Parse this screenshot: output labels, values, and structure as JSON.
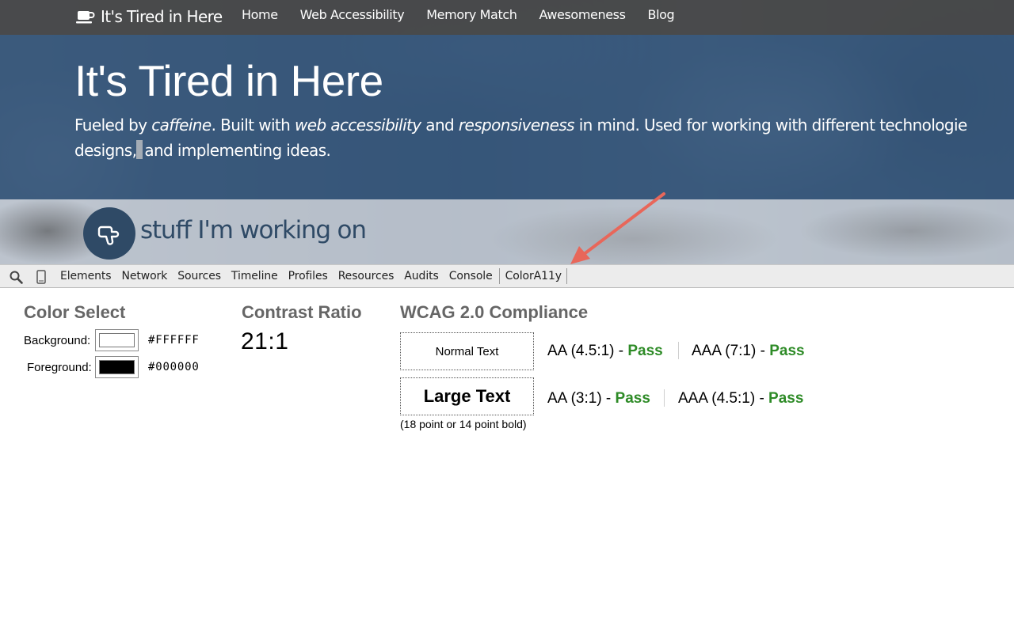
{
  "site": {
    "logo_text": "It's Tired in Here",
    "nav": [
      "Home",
      "Web Accessibility",
      "Memory Match",
      "Awesomeness",
      "Blog"
    ],
    "hero_title": "It's Tired in Here",
    "hero_sub": {
      "p1": "Fueled by ",
      "e1": "caffeine",
      "p2": ". Built with ",
      "e2": "web accessibility",
      "p3": " and ",
      "e3": "responsiveness",
      "p4": " in mind. Used for working with different technologie",
      "line2a": "designs,",
      "line2b": "and implementing ideas."
    },
    "section_title": "stuff I'm working on",
    "icons": {
      "logo": "coffee-cup-icon",
      "section": "pointing-hand-icon"
    }
  },
  "devtools": {
    "icons": {
      "search": "search-icon",
      "device": "mobile-device-icon"
    },
    "tabs": [
      "Elements",
      "Network",
      "Sources",
      "Timeline",
      "Profiles",
      "Resources",
      "Audits",
      "Console",
      "ColorA11y"
    ],
    "active_tab": "ColorA11y"
  },
  "color_select": {
    "heading": "Color Select",
    "background_label": "Background:",
    "background_hex": "#FFFFFF",
    "background_color": "#FFFFFF",
    "foreground_label": "Foreground:",
    "foreground_hex": "#000000",
    "foreground_color": "#000000"
  },
  "contrast": {
    "heading": "Contrast Ratio",
    "value": "21:1"
  },
  "wcag": {
    "heading": "WCAG 2.0 Compliance",
    "normal": {
      "sample": "Normal Text",
      "aa_label": "AA (4.5:1) - ",
      "aa_result": "Pass",
      "aaa_label": "AAA (7:1) - ",
      "aaa_result": "Pass"
    },
    "large": {
      "sample": "Large Text",
      "aa_label": "AA (3:1) - ",
      "aa_result": "Pass",
      "aaa_label": "AAA (4.5:1) - ",
      "aaa_result": "Pass"
    },
    "note": "(18 point or 14 point bold)",
    "pass_color": "#2E8B27"
  },
  "annotation": {
    "arrow_color": "#E8675A"
  }
}
